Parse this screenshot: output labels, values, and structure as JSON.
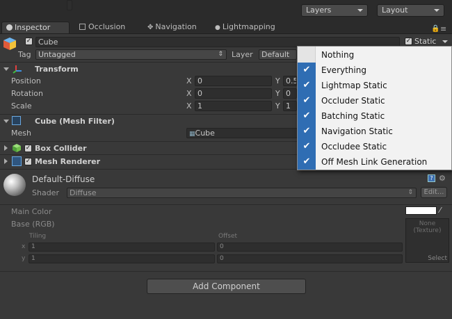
{
  "toolbar": {
    "layers": "Layers",
    "layout": "Layout"
  },
  "tabs": [
    {
      "label": "Inspector",
      "active": true
    },
    {
      "label": "Occlusion",
      "active": false
    },
    {
      "label": "Navigation",
      "active": false
    },
    {
      "label": "Lightmapping",
      "active": false
    }
  ],
  "object": {
    "name": "Cube",
    "static_label": "Static",
    "tag_label": "Tag",
    "tag_value": "Untagged",
    "layer_label": "Layer",
    "layer_value": "Default"
  },
  "transform": {
    "title": "Transform",
    "rows": [
      {
        "label": "Position",
        "x": "0",
        "y": "0.5"
      },
      {
        "label": "Rotation",
        "x": "0",
        "y": "0"
      },
      {
        "label": "Scale",
        "x": "1",
        "y": "1"
      }
    ],
    "x_axis": "X",
    "y_axis": "Y"
  },
  "mesh_filter": {
    "title": "Cube (Mesh Filter)",
    "mesh_label": "Mesh",
    "mesh_value": "Cube"
  },
  "box_collider": {
    "title": "Box Collider"
  },
  "mesh_renderer": {
    "title": "Mesh Renderer"
  },
  "material": {
    "name": "Default-Diffuse",
    "shader_label": "Shader",
    "shader_value": "Diffuse",
    "edit_label": "Edit...",
    "main_color_label": "Main Color",
    "base_label": "Base (RGB)",
    "tiling_label": "Tiling",
    "offset_label": "Offset",
    "tex_x": "x",
    "tex_y": "y",
    "tiling_x": "1",
    "tiling_y": "1",
    "offset_x": "0",
    "offset_y": "0",
    "texture_none": "None",
    "texture_type": "(Texture)",
    "select_label": "Select"
  },
  "add_component": "Add Component",
  "static_menu": [
    {
      "label": "Nothing",
      "checked": false
    },
    {
      "label": "Everything",
      "checked": true
    },
    {
      "label": "Lightmap Static",
      "checked": true
    },
    {
      "label": "Occluder Static",
      "checked": true
    },
    {
      "label": "Batching Static",
      "checked": true
    },
    {
      "label": "Navigation Static",
      "checked": true
    },
    {
      "label": "Occludee Static",
      "checked": true
    },
    {
      "label": "Off Mesh Link Generation",
      "checked": true
    }
  ],
  "colors": {
    "accent": "#2f6db3",
    "panel": "#393939",
    "main_color_swatch": "#ffffff"
  }
}
